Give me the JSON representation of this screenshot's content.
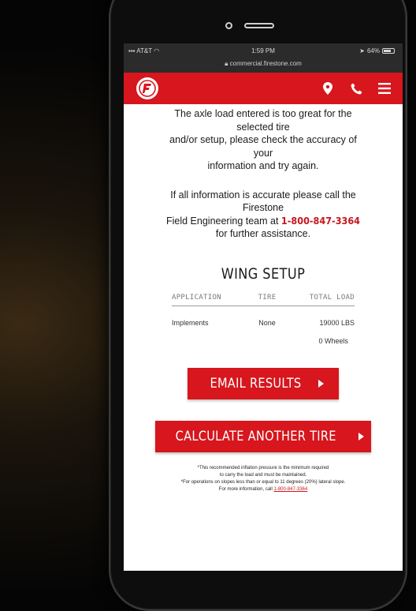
{
  "status_bar": {
    "carrier": "AT&T",
    "time": "1:59 PM",
    "battery": "64%",
    "battery_level": 0.64,
    "url": "commercial.firestone.com"
  },
  "nav": {
    "logo_letter": "F",
    "icons": [
      "location-pin-icon",
      "phone-icon",
      "hamburger-menu-icon"
    ]
  },
  "message": {
    "line1": "The axle load entered is too great for the",
    "line2": "selected tire",
    "line3": "and/or setup, please check the accuracy of",
    "line4": "your",
    "line5": "information and try again.",
    "line6": "If all information is accurate please call the",
    "line7": "Firestone",
    "line8_prefix": "Field Engineering team at",
    "phone": "1-800-847-3364",
    "line9": "for further assistance."
  },
  "section_title": "WING SETUP",
  "results": {
    "headers": [
      "APPLICATION",
      "TIRE",
      "TOTAL LOAD"
    ],
    "application": "Implements",
    "tire": "None",
    "total_load": "19000 LBS",
    "wheels": "0 Wheels"
  },
  "buttons": {
    "email": "EMAIL RESULTS",
    "calculate": "CALCULATE ANOTHER TIRE"
  },
  "footnote": {
    "line1": "*This recommended inflation pressure is the minimum required",
    "line2": "to carry the load and must be maintained.",
    "line3": "*For operations on slopes less than or equal to 11 degrees (20%) lateral slope.",
    "line4_prefix": "For more information, call",
    "phone": "1-800-847-3364"
  },
  "colors": {
    "brand_red": "#d7161d",
    "link_red": "#c8161d"
  }
}
